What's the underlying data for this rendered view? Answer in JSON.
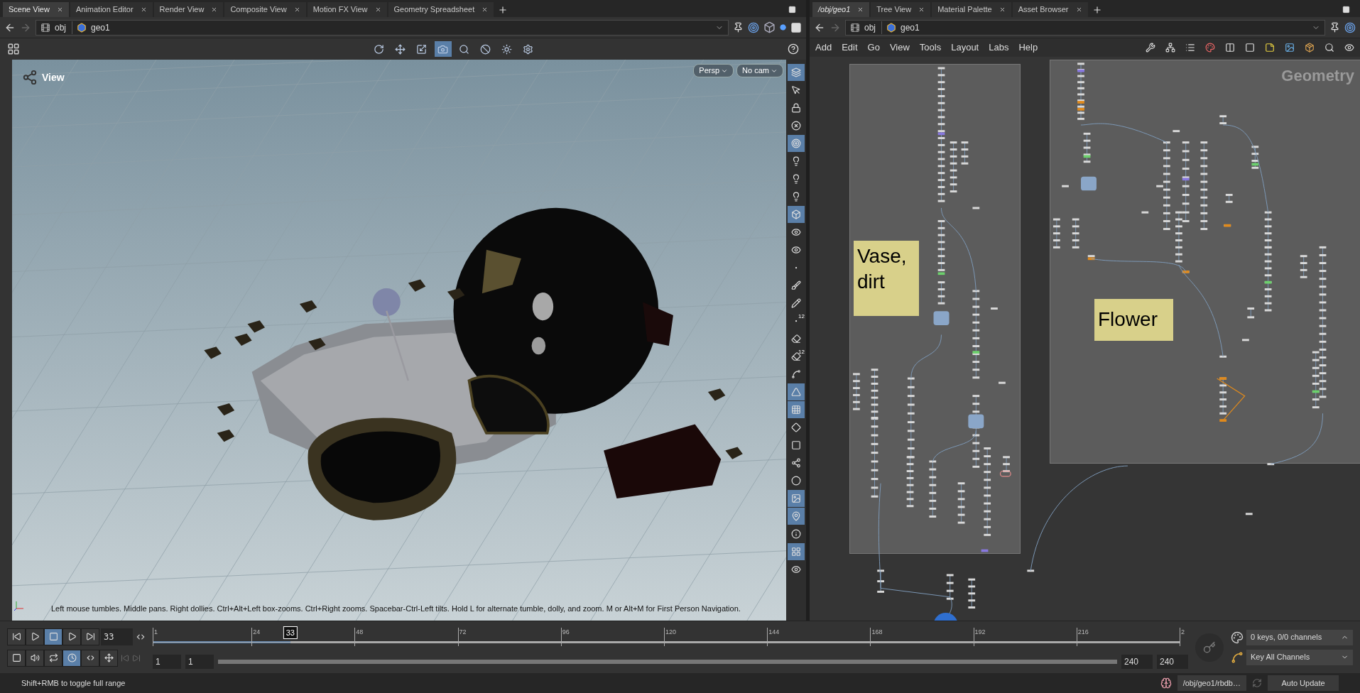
{
  "left_tabs": [
    {
      "label": "Scene View",
      "selected": true
    },
    {
      "label": "Animation Editor",
      "selected": false
    },
    {
      "label": "Render View",
      "selected": false
    },
    {
      "label": "Composite View",
      "selected": false
    },
    {
      "label": "Motion FX View",
      "selected": false
    },
    {
      "label": "Geometry Spreadsheet",
      "selected": false
    }
  ],
  "right_tabs": [
    {
      "label": "/obj/geo1",
      "selected": true
    },
    {
      "label": "Tree View",
      "selected": false
    },
    {
      "label": "Material Palette",
      "selected": false
    },
    {
      "label": "Asset Browser",
      "selected": false
    }
  ],
  "left_path": [
    "obj",
    "geo1"
  ],
  "right_path": [
    "obj",
    "geo1"
  ],
  "network_menu": [
    "Add",
    "Edit",
    "Go",
    "View",
    "Tools",
    "Layout",
    "Labs",
    "Help"
  ],
  "viewport": {
    "title": "View",
    "camera_menus": [
      "Persp",
      "No cam"
    ],
    "hint": "Left mouse tumbles. Middle pans. Right dollies. Ctrl+Alt+Left box-zooms. Ctrl+Right zooms. Spacebar-Ctrl-Left tilts. Hold L for alternate tumble, dolly, and zoom. M or Alt+M for First Person Navigation.",
    "view_tools": [
      {
        "on": false
      },
      {
        "on": false
      },
      {
        "on": false
      },
      {
        "on": true
      },
      {
        "on": false
      },
      {
        "on": false
      },
      {
        "on": false
      },
      {
        "on": false
      }
    ],
    "side_tools": [
      {
        "on": true
      },
      {
        "on": false
      },
      {
        "on": false
      },
      {
        "on": false
      },
      {
        "on": true
      },
      {
        "on": false
      },
      {
        "on": false
      },
      {
        "on": false
      },
      {
        "on": true
      },
      {
        "on": false
      },
      {
        "on": false
      },
      {
        "on": false
      },
      {
        "on": false
      },
      {
        "on": false
      },
      {
        "on": false,
        "label": "12"
      },
      {
        "on": false
      },
      {
        "on": false,
        "label": "12"
      },
      {
        "on": false
      },
      {
        "on": true
      },
      {
        "on": true
      },
      {
        "on": false
      },
      {
        "on": false
      },
      {
        "on": false
      },
      {
        "on": false
      },
      {
        "on": true
      },
      {
        "on": true
      },
      {
        "on": false
      },
      {
        "on": true
      },
      {
        "on": false
      }
    ]
  },
  "network": {
    "context_label": "Geometry",
    "sticky_notes": [
      "Vase, dirt",
      "Flower"
    ]
  },
  "timeline": {
    "frame": "33",
    "playhead": {
      "label": "33",
      "level": 0.134
    },
    "tick_labels": [
      "1",
      "24",
      "48",
      "72",
      "96",
      "120",
      "144",
      "168",
      "192",
      "216",
      "2"
    ],
    "range": [
      "1",
      "1",
      "240",
      "240"
    ],
    "range_bar": {
      "level": 1.0
    },
    "transport": [
      {
        "on": false
      },
      {
        "on": false
      },
      {
        "on": true
      },
      {
        "on": false
      },
      {
        "on": false
      }
    ],
    "playbar_tools": [
      {
        "on": false
      },
      {
        "on": false
      },
      {
        "on": false
      },
      {
        "on": true
      },
      {
        "on": false
      },
      {
        "on": false
      }
    ],
    "keys_label": "0 keys, 0/0 channels",
    "key_mode": "Key All Channels"
  },
  "status": {
    "message": "Shift+RMB to toggle full range",
    "path": "/obj/geo1/rbdb…",
    "update_mode": "Auto Update"
  }
}
